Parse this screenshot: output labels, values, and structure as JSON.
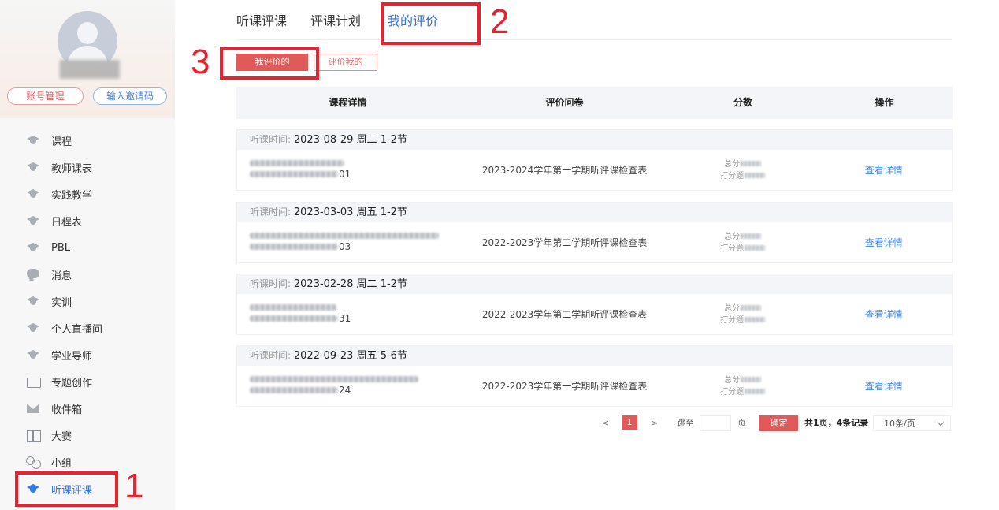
{
  "sidebar": {
    "buttons": {
      "account": "账号管理",
      "invite": "输入邀请码"
    },
    "items": [
      {
        "label": "课程",
        "icon": "graduation-cap-icon"
      },
      {
        "label": "教师课表",
        "icon": "graduation-cap-icon"
      },
      {
        "label": "实践教学",
        "icon": "graduation-cap-icon"
      },
      {
        "label": "日程表",
        "icon": "graduation-cap-icon"
      },
      {
        "label": "PBL",
        "icon": "graduation-cap-icon"
      },
      {
        "label": "消息",
        "icon": "message-icon"
      },
      {
        "label": "实训",
        "icon": "graduation-cap-icon"
      },
      {
        "label": "个人直播间",
        "icon": "graduation-cap-icon"
      },
      {
        "label": "学业导师",
        "icon": "graduation-cap-icon"
      },
      {
        "label": "专题创作",
        "icon": "frame-icon"
      },
      {
        "label": "收件箱",
        "icon": "inbox-icon"
      },
      {
        "label": "大赛",
        "icon": "book-icon"
      },
      {
        "label": "小组",
        "icon": "group-icon"
      },
      {
        "label": "听课评课",
        "icon": "graduation-cap-icon",
        "active": true
      }
    ]
  },
  "annotations": {
    "n1": "1",
    "n2": "2",
    "n3": "3",
    "color": "#e8232f"
  },
  "tabs": [
    "听课评课",
    "评课计划",
    "我的评价"
  ],
  "sub_tabs": [
    "我评价的",
    "评价我的"
  ],
  "table": {
    "headers": [
      "课程详情",
      "评价问卷",
      "分数",
      "操作"
    ],
    "time_label": "听课时间:",
    "total_label": "总分",
    "scored_label": "打分题",
    "action_label": "查看详情",
    "rows": [
      {
        "time": "2023-08-29 周二 1-2节",
        "code_suffix": "01",
        "paper": "2023-2024学年第一学期听评课检查表"
      },
      {
        "time": "2023-03-03 周五 1-2节",
        "code_suffix": "03",
        "paper": "2022-2023学年第二学期听评课检查表"
      },
      {
        "time": "2023-02-28 周二 1-2节",
        "code_suffix": "31",
        "paper": "2022-2023学年第二学期听评课检查表"
      },
      {
        "time": "2022-09-23 周五 5-6节",
        "code_suffix": "24",
        "paper": "2022-2023学年第一学期听评课检查表"
      }
    ]
  },
  "pager": {
    "prev": "<",
    "current": "1",
    "next": ">",
    "jump_label": "跳至",
    "page_label": "页",
    "confirm": "确定",
    "total": "共1页，4条记录",
    "page_size": "10条/页"
  },
  "colors": {
    "accent_blue": "#2f6fde",
    "accent_red": "#e05a5a",
    "link": "#3c86ea"
  }
}
